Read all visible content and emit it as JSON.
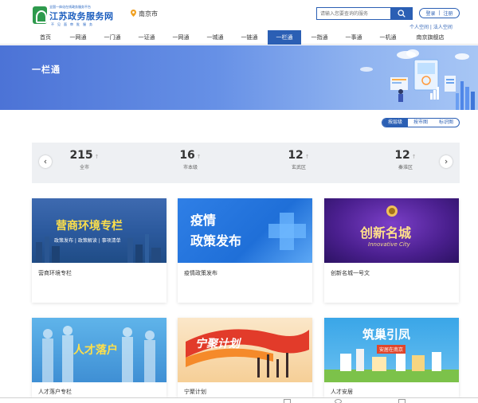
{
  "header": {
    "logo_sub": "全国一体化在线政务服务平台",
    "logo_title": "江苏政务服务网",
    "logo_slogan": "不见面审批服务",
    "location": "南京市",
    "search_placeholder": "请输入您要查询的服务",
    "login": "登录",
    "divider": "|",
    "register": "注册",
    "user_links": "个人空间 | 法人空间"
  },
  "nav": {
    "items": [
      "首页",
      "一网通",
      "一门通",
      "一证通",
      "一网通",
      "一城通",
      "一链通",
      "一栏通",
      "一指通",
      "一事通",
      "一机通",
      "南京旗舰店"
    ],
    "active_index": 7
  },
  "banner": {
    "title": "一栏通"
  },
  "view_tabs": {
    "items": [
      "按层级",
      "按市图",
      "标识图"
    ],
    "active_index": 0
  },
  "stats": {
    "items": [
      {
        "value": "215",
        "label": "全市"
      },
      {
        "value": "16",
        "label": "市本级"
      },
      {
        "value": "12",
        "label": "玄武区"
      },
      {
        "value": "12",
        "label": "秦淮区"
      }
    ]
  },
  "cards": [
    {
      "image_title": "营商环境专栏",
      "image_subtitle": "政策发布 | 政策解读 | 事项清单",
      "caption": "营商环境专栏"
    },
    {
      "image_title_1": "疫情",
      "image_title_2": "政策发布",
      "caption": "疫情政策发布"
    },
    {
      "image_title": "创新名城",
      "image_subtitle": "Innovative City",
      "caption": "创新名城一号文"
    },
    {
      "image_title": "人才落户",
      "caption": "人才落户专栏"
    },
    {
      "image_title": "宁聚计划",
      "caption": "宁聚计划"
    },
    {
      "image_title": "筑巢引凤",
      "image_subtitle": "安居在南京",
      "caption": "人才安居"
    }
  ],
  "colors": {
    "primary": "#2b5fb4",
    "banner_start": "#4c73d6",
    "stats_bg": "#eef0f3"
  }
}
